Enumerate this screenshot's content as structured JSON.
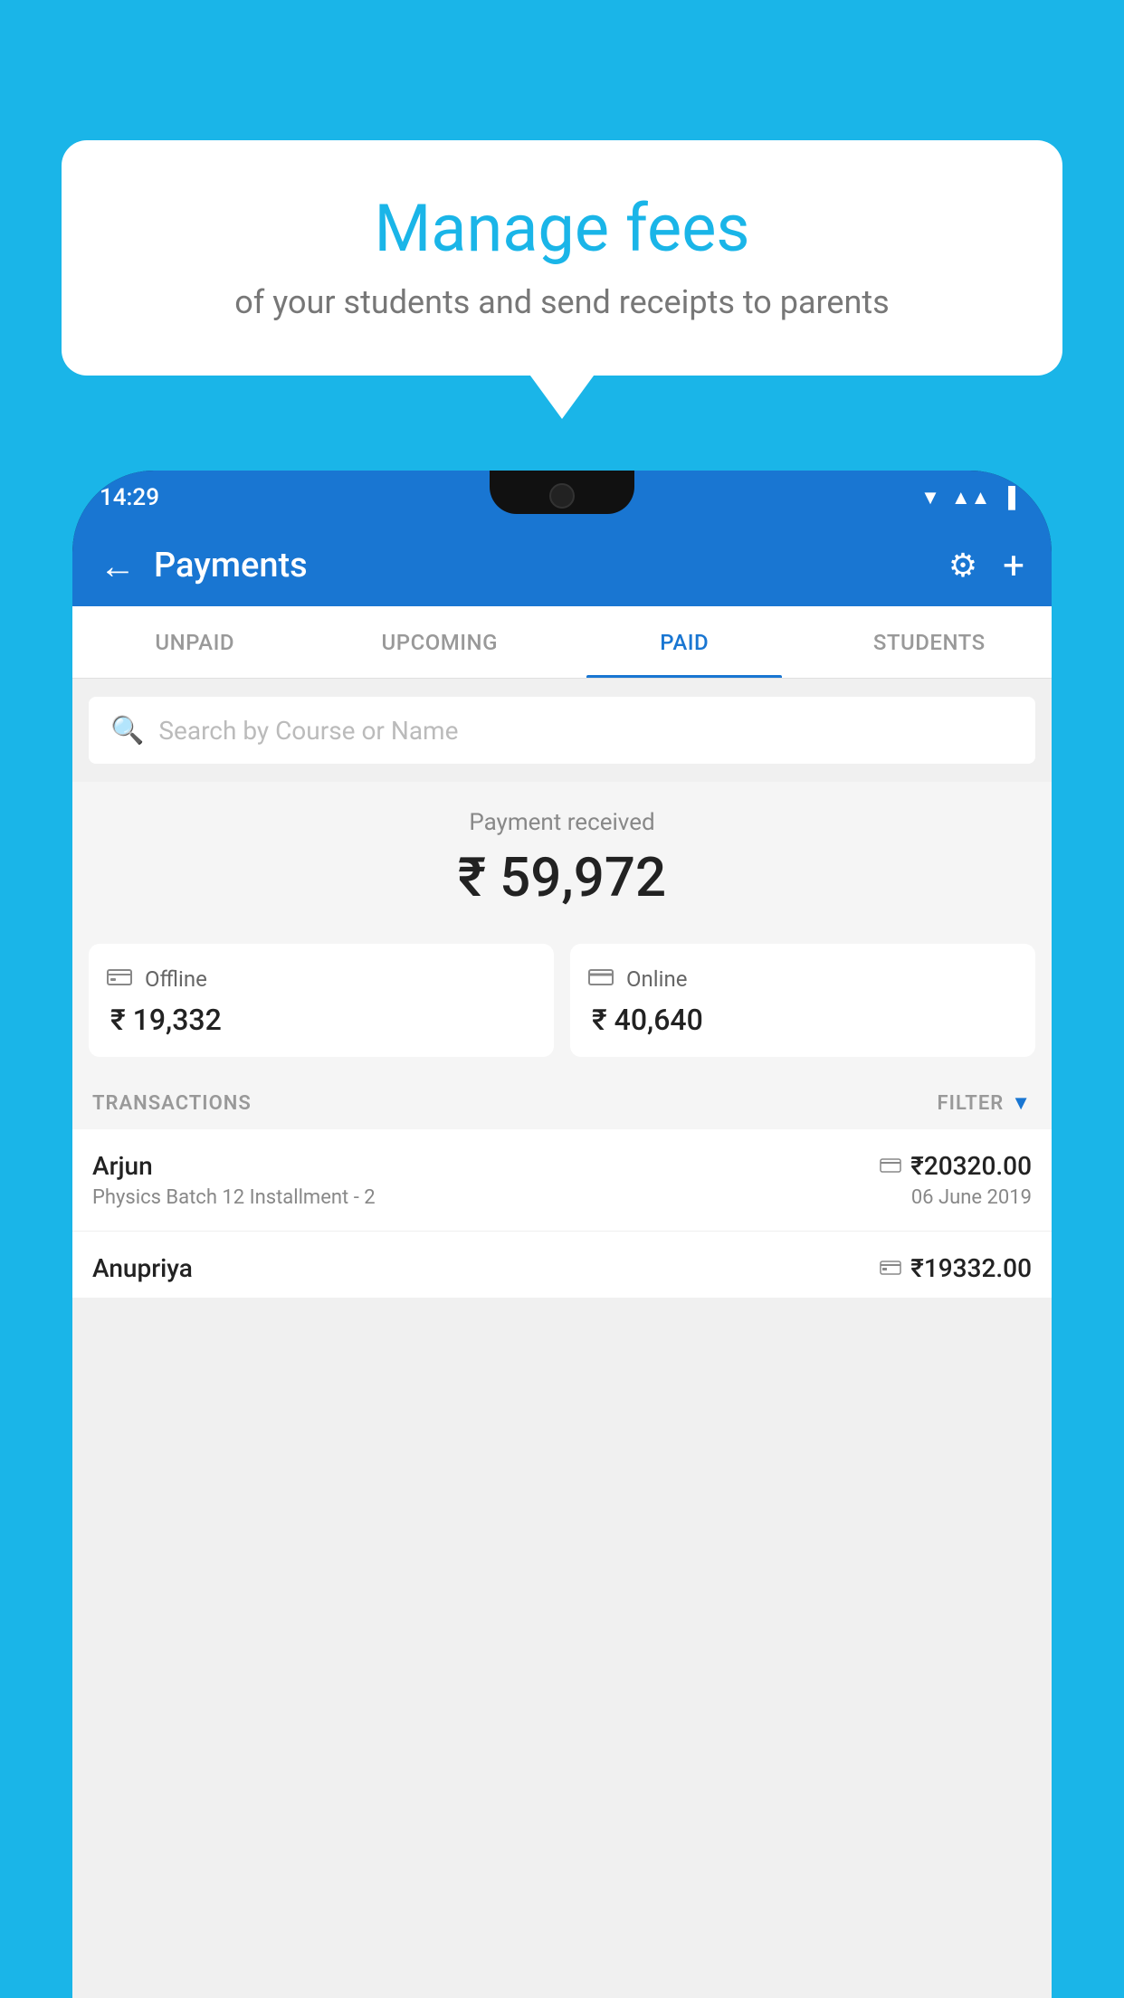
{
  "background": {
    "color": "#1ab5e8"
  },
  "speech_bubble": {
    "title": "Manage fees",
    "subtitle": "of your students and send receipts to parents"
  },
  "phone": {
    "status_bar": {
      "time": "14:29"
    },
    "app_bar": {
      "title": "Payments",
      "back_label": "←",
      "gear_label": "⚙",
      "plus_label": "+"
    },
    "tabs": [
      {
        "label": "UNPAID",
        "active": false
      },
      {
        "label": "UPCOMING",
        "active": false
      },
      {
        "label": "PAID",
        "active": true
      },
      {
        "label": "STUDENTS",
        "active": false
      }
    ],
    "search": {
      "placeholder": "Search by Course or Name"
    },
    "payment_received": {
      "label": "Payment received",
      "amount": "₹ 59,972"
    },
    "cards": [
      {
        "type": "Offline",
        "icon": "💳",
        "amount": "₹ 19,332"
      },
      {
        "type": "Online",
        "icon": "💳",
        "amount": "₹ 40,640"
      }
    ],
    "transactions": {
      "header_label": "TRANSACTIONS",
      "filter_label": "FILTER",
      "rows": [
        {
          "name": "Arjun",
          "course": "Physics Batch 12 Installment - 2",
          "amount": "₹20320.00",
          "date": "06 June 2019",
          "payment_type": "online"
        },
        {
          "name": "Anupriya",
          "course": "",
          "amount": "₹19332.00",
          "date": "",
          "payment_type": "offline"
        }
      ]
    }
  }
}
